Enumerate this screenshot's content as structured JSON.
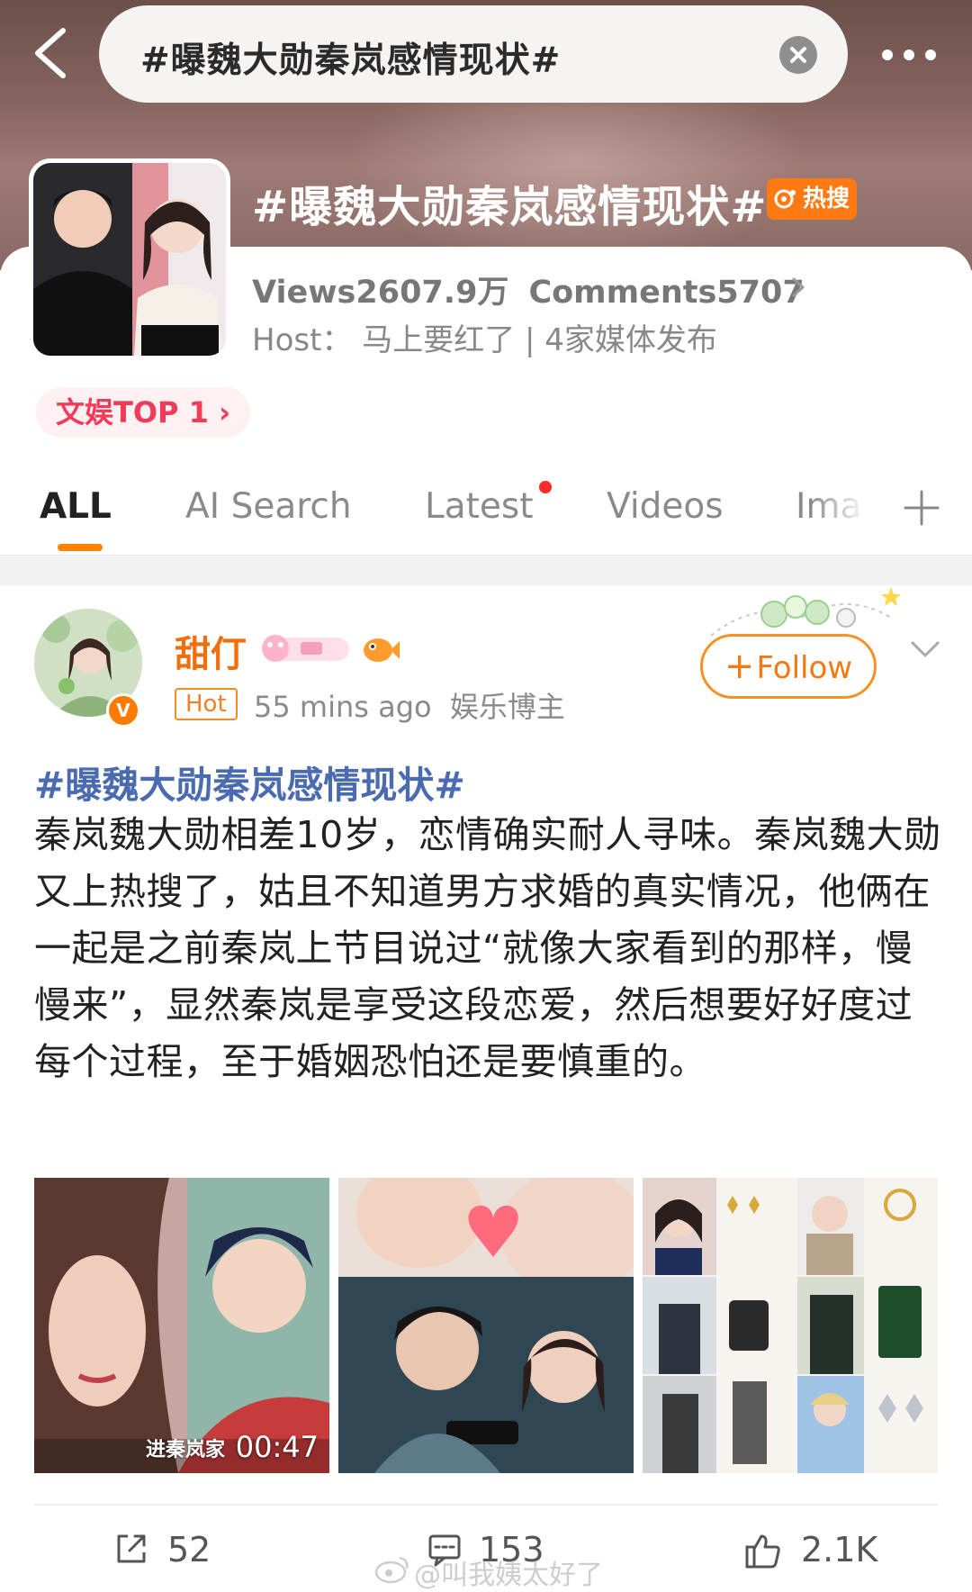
{
  "header": {
    "search_query": "#曝魏大勋秦岚感情现状#",
    "back_icon": "chevron-left-icon",
    "clear_icon": "clear-circle-icon",
    "more_icon": "more-dots-icon"
  },
  "topic": {
    "title": "#曝魏大勋秦岚感情现状#",
    "hot_badge": "热搜",
    "views": "Views2607.9万",
    "comments": "Comments5707",
    "host_line": "Host：  马上要红了 | 4家媒体发布",
    "rank": "文娱TOP 1 ›"
  },
  "tabs": [
    {
      "label": "ALL",
      "active": true
    },
    {
      "label": "AI Search",
      "active": false
    },
    {
      "label": "Latest",
      "active": false,
      "has_dot": true
    },
    {
      "label": "Videos",
      "active": false
    },
    {
      "label": "Ima",
      "active": false
    }
  ],
  "post": {
    "username": "甜仃",
    "verified_badge": "V",
    "hot_tag": "Hot",
    "time": "55 mins ago",
    "category": "娱乐博主",
    "follow_plus": "+",
    "follow_label": "Follow",
    "topic_link": "#曝魏大勋秦岚感情现状#",
    "body": "秦岚魏大勋相差10岁，恋情确实耐人寻味。秦岚魏大勋又上热搜了，姑且不知道男方求婚的真实情况，他俩在一起是之前秦岚上节目说过“就像大家看到的那样，慢慢来”，显然秦岚是享受这段恋爱，然后想要好好度过每个过程，至于婚姻恐怕还是要慎重的。",
    "video_duration": "00:47",
    "video_watermark": "进秦岚家"
  },
  "actions": {
    "repost_count": "52",
    "comment_count": "153",
    "like_count": "2.1K"
  },
  "watermark": "@叫我姨太好了",
  "colors": {
    "accent_orange": "#ff8200",
    "topic_blue": "#4a6bb0",
    "hot_badge": "#ff7a12",
    "rank_red": "#f03c5a"
  }
}
